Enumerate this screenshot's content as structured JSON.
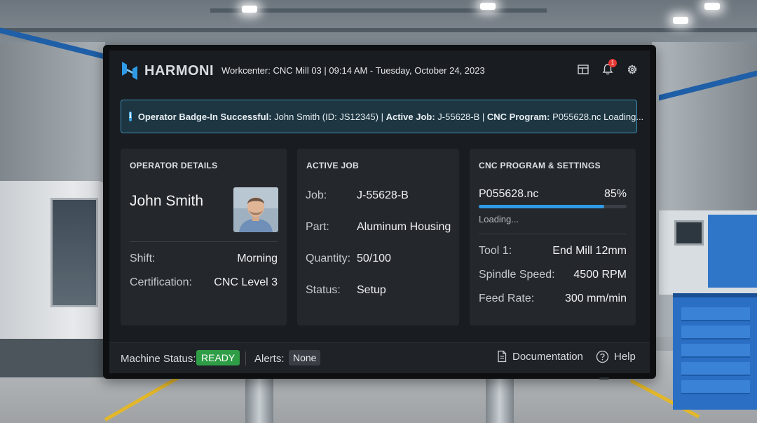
{
  "app": {
    "brand": "HARMONI",
    "workcenter_line": "Workcenter: CNC Mill 03 | 09:14 AM - Tuesday, October 24, 2023",
    "notification_count": "1"
  },
  "banner": {
    "label1": "Operator Badge-In Successful:",
    "text1": " John Smith (ID: JS12345) | ",
    "label2": "Active Job:",
    "text2": " J-55628-B | ",
    "label3": "CNC Program:",
    "text3": " P055628.nc Loading..."
  },
  "operator": {
    "title": "OPERATOR DETAILS",
    "name": "John Smith",
    "rows": [
      {
        "label": "Shift:",
        "value": "Morning"
      },
      {
        "label": "Certification:",
        "value": "CNC Level 3"
      }
    ]
  },
  "job": {
    "title": "ACTIVE JOB",
    "rows": [
      {
        "label": "Job:",
        "value": "J-55628-B"
      },
      {
        "label": "Part:",
        "value": "Aluminum Housing"
      },
      {
        "label": "Quantity:",
        "value": "50/100"
      },
      {
        "label": "Status:",
        "value": "Setup"
      }
    ]
  },
  "program": {
    "title": "CNC PROGRAM & SETTINGS",
    "file": "P055628.nc",
    "progress_label": "85%",
    "progress": 0.85,
    "loading": "Loading...",
    "rows": [
      {
        "label": "Tool 1:",
        "value": "End Mill 12mm"
      },
      {
        "label": "Spindle Speed:",
        "value": "4500 RPM"
      },
      {
        "label": "Feed Rate:",
        "value": "300 mm/min"
      }
    ]
  },
  "footer": {
    "machine_status_label": "Machine Status:",
    "machine_status": "READY",
    "alerts_label": "Alerts:",
    "alerts_value": "None",
    "documentation": "Documentation",
    "help": "Help"
  },
  "colors": {
    "accent": "#2f9be6",
    "ready": "#2e9d46",
    "notification": "#e53935",
    "banner_border": "#3b8db4"
  },
  "icons": [
    "harmoni-logo",
    "layout-icon",
    "bell-icon",
    "gear-icon",
    "info-icon",
    "document-icon",
    "help-icon"
  ]
}
